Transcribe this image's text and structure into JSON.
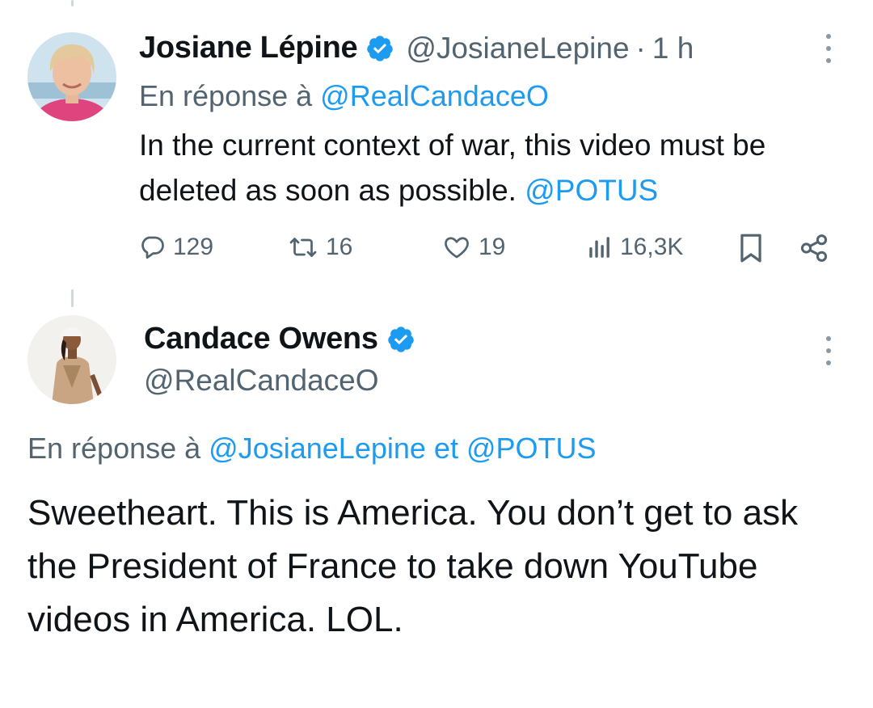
{
  "reply_tweet": {
    "author": {
      "display_name": "Josiane Lépine",
      "handle": "@JosianeLepine",
      "verified": true
    },
    "separator": "·",
    "time": "1 h",
    "reply_prefix": "En réponse à",
    "reply_to": "@RealCandaceO",
    "text_lead": "In the current context of war, this video must be deleted as soon as possible.",
    "text_mention": "@POTUS",
    "actions": {
      "replies": "129",
      "retweets": "16",
      "likes": "19",
      "views": "16,3K"
    }
  },
  "main_tweet": {
    "author": {
      "display_name": "Candace Owens",
      "handle": "@RealCandaceO",
      "verified": true
    },
    "reply_prefix": "En réponse à",
    "reply_to_1": "@JosianeLepine",
    "reply_joiner": "et",
    "reply_to_2": "@POTUS",
    "text": "Sweetheart. This is America. You don’t get to ask the President of France to take down YouTube videos in America. LOL."
  },
  "colors": {
    "text": "#0f1419",
    "secondary": "#536471",
    "accent": "#1d9bf0",
    "thread_line": "#cfd9de"
  },
  "icons": [
    "verified-badge-icon",
    "more-options-icon",
    "reply-icon",
    "retweet-icon",
    "like-icon",
    "views-icon",
    "bookmark-icon",
    "share-icon"
  ]
}
